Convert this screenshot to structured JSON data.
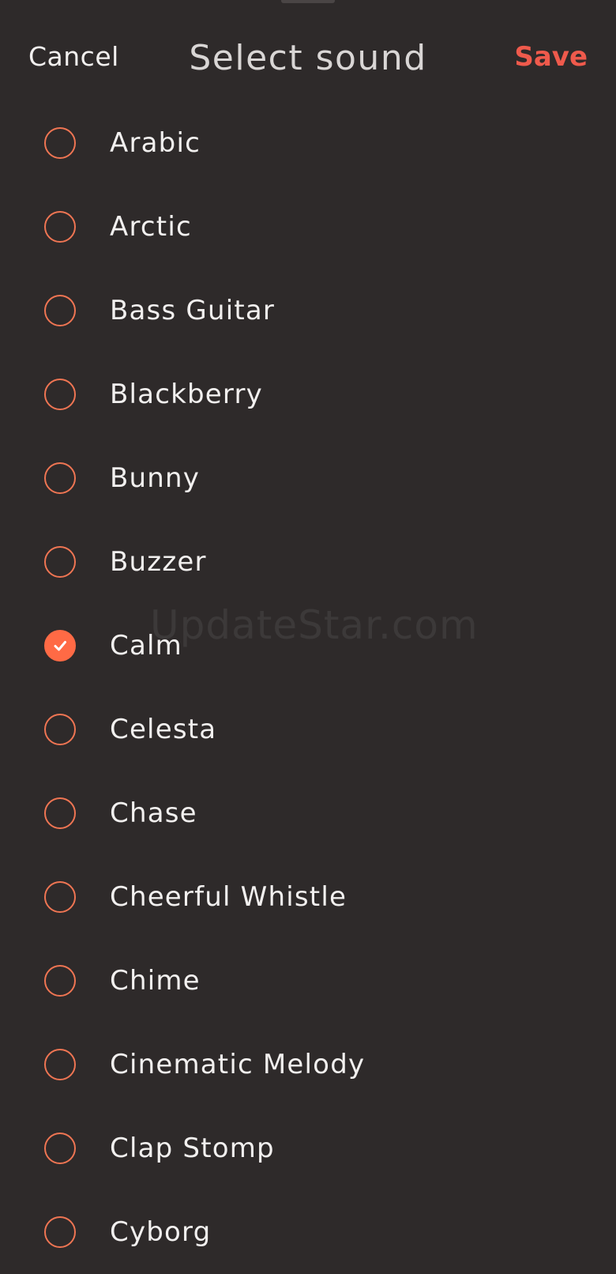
{
  "header": {
    "cancel_label": "Cancel",
    "title": "Select sound",
    "save_label": "Save"
  },
  "sounds": [
    {
      "label": "Arabic",
      "selected": false
    },
    {
      "label": "Arctic",
      "selected": false
    },
    {
      "label": "Bass Guitar",
      "selected": false
    },
    {
      "label": "Blackberry",
      "selected": false
    },
    {
      "label": "Bunny",
      "selected": false
    },
    {
      "label": "Buzzer",
      "selected": false
    },
    {
      "label": "Calm",
      "selected": true
    },
    {
      "label": "Celesta",
      "selected": false
    },
    {
      "label": "Chase",
      "selected": false
    },
    {
      "label": "Cheerful Whistle",
      "selected": false
    },
    {
      "label": "Chime",
      "selected": false
    },
    {
      "label": "Cinematic Melody",
      "selected": false
    },
    {
      "label": "Clap Stomp",
      "selected": false
    },
    {
      "label": "Cyborg",
      "selected": false
    }
  ],
  "watermark": "UpdateStar.com",
  "colors": {
    "background": "#2e2a2a",
    "accent": "#ef5a4c",
    "radio": "#ef7553",
    "radio_checked": "#ff6a45"
  },
  "icons": {
    "radio_unchecked": "radio-unchecked-icon",
    "radio_checked": "checkmark-icon"
  }
}
